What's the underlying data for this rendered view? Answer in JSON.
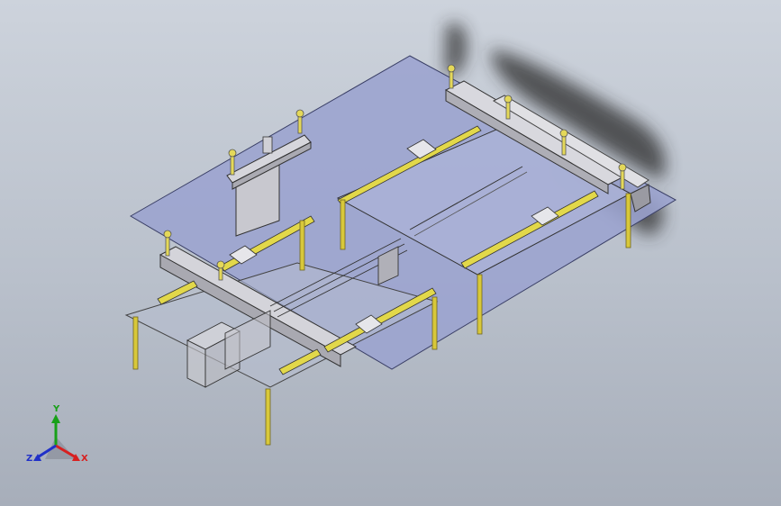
{
  "viewport": {
    "colors": {
      "bg_top": "#cdd3dc",
      "bg_bottom": "#a7aeba",
      "plate": "#9ba3cf",
      "plate_edge": "#3a3f66",
      "rail": "#e2d84a",
      "beam": "#c3c3c8",
      "post": "#d8c83a",
      "edge": "#333333"
    }
  },
  "triad": {
    "x_label": "X",
    "y_label": "Y",
    "z_label": "Z",
    "colors": {
      "x": "#d82020",
      "y": "#18a018",
      "z": "#2030c8"
    }
  }
}
